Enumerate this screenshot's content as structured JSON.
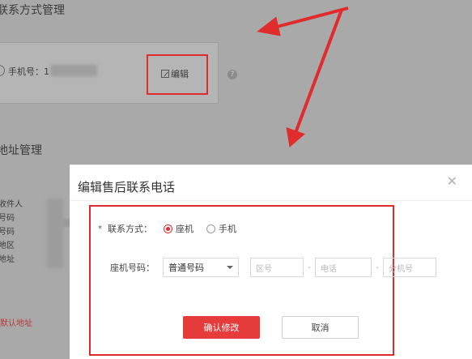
{
  "background": {
    "section_title": "联系方式管理",
    "phone_label": "手机号：1",
    "edit_label": "编辑",
    "help_icon": "question-icon",
    "address_section_title": "地址管理",
    "address_labels": [
      "收件人",
      "号码",
      "号码",
      "地区",
      "地址"
    ],
    "default_address_link": "默认地址"
  },
  "modal": {
    "title": "编辑售后联系电话",
    "close_icon": "close-icon",
    "contact_method_label": "联系方式：",
    "required_marker": "*",
    "options": [
      "座机",
      "手机"
    ],
    "selected_option": "座机",
    "landline_label": "座机号码：",
    "select_value": "普通号码",
    "area_code_placeholder": "区号",
    "phone_placeholder": "电话",
    "extension_placeholder": "分机号",
    "separator": "-",
    "confirm_button": "确认修改",
    "cancel_button": "取消"
  },
  "colors": {
    "accent": "#e63b3b",
    "highlight_border": "#e02c2c",
    "overlay": "#a9a9a9"
  }
}
